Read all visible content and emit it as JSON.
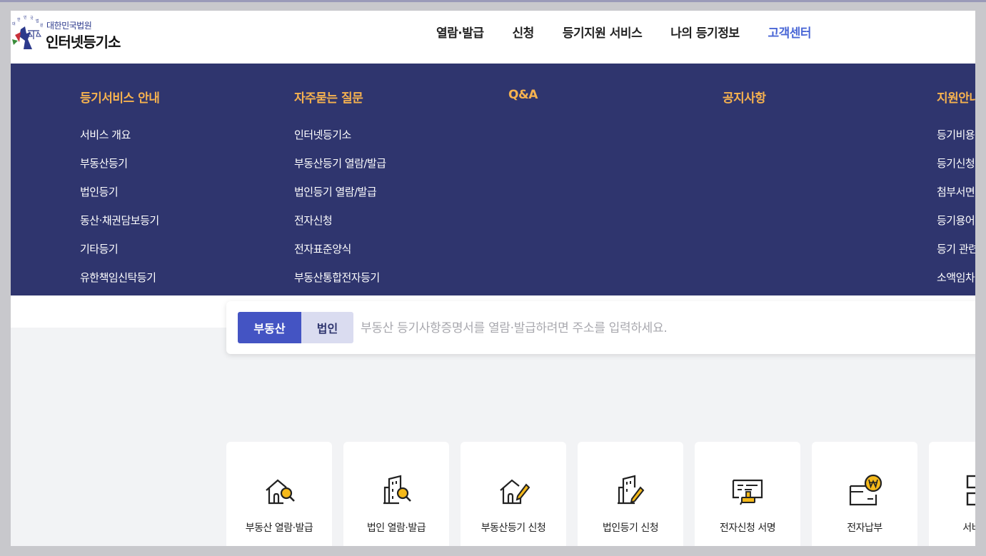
{
  "logo": {
    "subtitle": "대한민국법원",
    "title": "인터넷등기소"
  },
  "nav": {
    "items": [
      {
        "label": "열람·발급"
      },
      {
        "label": "신청"
      },
      {
        "label": "등기지원 서비스"
      },
      {
        "label": "나의 등기정보"
      },
      {
        "label": "고객센터"
      }
    ],
    "active_color": "#4a67d6"
  },
  "mega_menu": {
    "background": "#2f356e",
    "heading_color": "#f6b24f",
    "columns": [
      {
        "heading": "등기서비스 안내",
        "items": [
          "서비스 개요",
          "부동산등기",
          "법인등기",
          "동산·채권담보등기",
          "기타등기",
          "유한책임신탁등기"
        ]
      },
      {
        "heading": "자주묻는 질문",
        "items": [
          "인터넷등기소",
          "부동산등기 열람/발급",
          "법인등기 열람/발급",
          "전자신청",
          "전자표준양식",
          "부동산통합전자등기"
        ]
      },
      {
        "heading": "Q&A",
        "items": []
      },
      {
        "heading": "공지사항",
        "items": []
      },
      {
        "heading": "지원안내",
        "items": [
          "등기비용 안",
          "등기신청양",
          "첨부서면예",
          "등기용어해",
          "등기 관련 법",
          "소액임차인"
        ]
      }
    ]
  },
  "search": {
    "tabs": [
      {
        "label": "부동산"
      },
      {
        "label": "법인"
      }
    ],
    "placeholder": "부동산 등기사항증명서를 열람·발급하려면 주소를 입력하세요.",
    "active_color": "#4454c3"
  },
  "quick_menu": [
    {
      "label": "부동산 열람·발급",
      "icon": "house-search-icon"
    },
    {
      "label": "법인 열람·발급",
      "icon": "building-search-icon"
    },
    {
      "label": "부동산등기 신청",
      "icon": "house-pencil-icon"
    },
    {
      "label": "법인등기 신청",
      "icon": "building-pencil-icon"
    },
    {
      "label": "전자신청 서명",
      "icon": "certificate-stamp-icon"
    },
    {
      "label": "전자납부",
      "icon": "won-wallet-icon"
    },
    {
      "label": "서비스 더",
      "icon": "grid-icon"
    }
  ]
}
